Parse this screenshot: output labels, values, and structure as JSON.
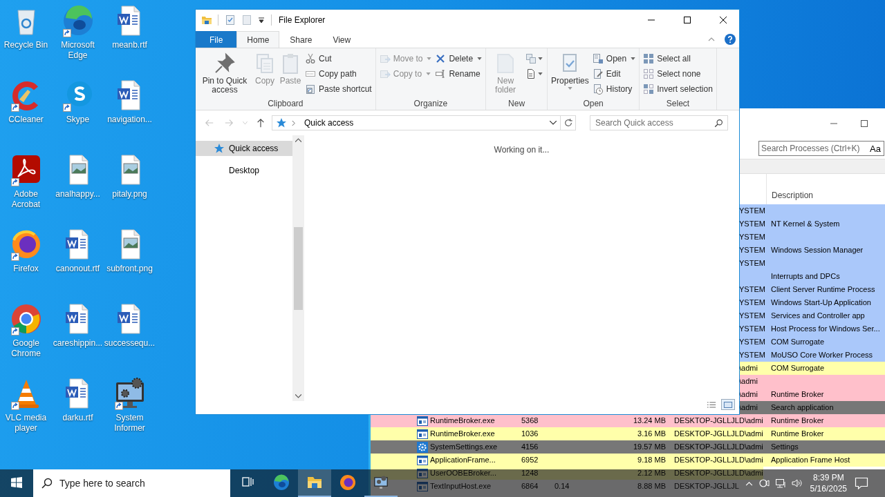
{
  "desktop_icons": [
    {
      "label": "Recycle Bin",
      "kind": "recycle",
      "shortcut": false
    },
    {
      "label": "Microsoft Edge",
      "kind": "edge",
      "shortcut": true
    },
    {
      "label": "meanb.rtf",
      "kind": "word",
      "shortcut": false
    },
    {
      "label": "CCleaner",
      "kind": "ccleaner",
      "shortcut": true
    },
    {
      "label": "Skype",
      "kind": "skype",
      "shortcut": true
    },
    {
      "label": "navigation...",
      "kind": "word",
      "shortcut": false
    },
    {
      "label": "Adobe Acrobat",
      "kind": "acrobat",
      "shortcut": true
    },
    {
      "label": "analhappy...",
      "kind": "image",
      "shortcut": false
    },
    {
      "label": "pitaly.png",
      "kind": "image",
      "shortcut": false
    },
    {
      "label": "Firefox",
      "kind": "firefox",
      "shortcut": true
    },
    {
      "label": "canonout.rtf",
      "kind": "word",
      "shortcut": false
    },
    {
      "label": "subfront.png",
      "kind": "image",
      "shortcut": false
    },
    {
      "label": "Google Chrome",
      "kind": "chrome",
      "shortcut": true
    },
    {
      "label": "careshippin...",
      "kind": "word",
      "shortcut": false
    },
    {
      "label": "successequ...",
      "kind": "word",
      "shortcut": false
    },
    {
      "label": "VLC media player",
      "kind": "vlc",
      "shortcut": true
    },
    {
      "label": "darku.rtf",
      "kind": "word",
      "shortcut": false
    },
    {
      "label": "System Informer",
      "kind": "sysinf",
      "shortcut": true
    }
  ],
  "explorer": {
    "title": "File Explorer",
    "tabs": [
      {
        "label": "File",
        "kind": "file",
        "selected": false
      },
      {
        "label": "Home",
        "kind": "tab",
        "selected": true
      },
      {
        "label": "Share",
        "kind": "tab",
        "selected": false
      },
      {
        "label": "View",
        "kind": "tab",
        "selected": false
      }
    ],
    "ribbon": [
      {
        "label": "Clipboard",
        "columns": [
          [
            {
              "label": "Pin to Quick access",
              "kind": "large",
              "disabled": false,
              "dropdown": false
            }
          ],
          [
            {
              "label": "Copy",
              "kind": "large",
              "disabled": true,
              "dropdown": false
            }
          ],
          [
            {
              "label": "Paste",
              "kind": "large",
              "disabled": true,
              "dropdown": false
            }
          ],
          [
            {
              "label": "Cut",
              "kind": "small",
              "disabled": false,
              "dropdown": false
            },
            {
              "label": "Copy path",
              "kind": "small",
              "disabled": false,
              "dropdown": false
            },
            {
              "label": "Paste shortcut",
              "kind": "small",
              "disabled": false,
              "dropdown": false
            }
          ]
        ]
      },
      {
        "label": "Organize",
        "columns": [
          [
            {
              "label": "Move to",
              "kind": "small",
              "disabled": true,
              "dropdown": true
            },
            {
              "label": "Copy to",
              "kind": "small",
              "disabled": true,
              "dropdown": true
            }
          ],
          [
            {
              "label": "Delete",
              "kind": "small",
              "disabled": false,
              "dropdown": true
            },
            {
              "label": "Rename",
              "kind": "small",
              "disabled": false,
              "dropdown": false
            }
          ]
        ]
      },
      {
        "label": "New",
        "columns": [
          [
            {
              "label": "New folder",
              "kind": "large",
              "disabled": true,
              "dropdown": false
            }
          ],
          [
            {
              "kind": "icon",
              "disabled": false,
              "dropdown": true
            },
            {
              "kind": "icon",
              "disabled": false,
              "dropdown": true
            }
          ]
        ]
      },
      {
        "label": "Open",
        "columns": [
          [
            {
              "label": "Properties",
              "kind": "large",
              "disabled": false,
              "dropdown": true
            }
          ],
          [
            {
              "label": "Open",
              "kind": "small",
              "disabled": false,
              "dropdown": true
            },
            {
              "label": "Edit",
              "kind": "small",
              "disabled": false,
              "dropdown": false
            },
            {
              "label": "History",
              "kind": "small",
              "disabled": false,
              "dropdown": false
            }
          ]
        ]
      },
      {
        "label": "Select",
        "columns": [
          [
            {
              "label": "Select all",
              "kind": "small",
              "disabled": false,
              "dropdown": false
            },
            {
              "label": "Select none",
              "kind": "small",
              "disabled": false,
              "dropdown": false
            },
            {
              "label": "Invert selection",
              "kind": "small",
              "disabled": false,
              "dropdown": false
            }
          ]
        ]
      }
    ],
    "address": "Quick access",
    "search_placeholder": "Search Quick access",
    "nav": [
      {
        "label": "Quick access",
        "selected": true
      },
      {
        "label": "Desktop",
        "selected": false
      }
    ],
    "status": "Working on it..."
  },
  "process_window": {
    "search_placeholder": "Search Processes (Ctrl+K)",
    "case_toggle": "Aa",
    "columns": [
      {
        "label": "Description"
      }
    ],
    "rows": [
      {
        "kind": "covered",
        "user": "YSTEM",
        "color": "#aac8fa"
      },
      {
        "kind": "covered",
        "user": "YSTEM",
        "description": "NT Kernel & System",
        "color": "#aac8fa"
      },
      {
        "kind": "covered",
        "user": "YSTEM",
        "color": "#aac8fa"
      },
      {
        "kind": "covered",
        "user": "YSTEM",
        "description": "Windows Session Manager",
        "color": "#aac8fa"
      },
      {
        "kind": "covered",
        "user": "YSTEM",
        "color": "#aac8fa"
      },
      {
        "kind": "covered",
        "description": "Interrupts and DPCs",
        "color": "#aac8fa"
      },
      {
        "kind": "covered",
        "user": "YSTEM",
        "description": "Client Server Runtime Process",
        "color": "#aac8fa"
      },
      {
        "kind": "covered",
        "user": "YSTEM",
        "description": "Windows Start-Up Application",
        "color": "#aac8fa"
      },
      {
        "kind": "covered",
        "user": "YSTEM",
        "description": "Services and Controller app",
        "color": "#aac8fa"
      },
      {
        "kind": "covered",
        "user": "YSTEM",
        "description": "Host Process for Windows Ser...",
        "color": "#aac8fa"
      },
      {
        "kind": "covered",
        "user": "YSTEM",
        "description": "COM Surrogate",
        "color": "#aac8fa"
      },
      {
        "kind": "covered",
        "user": "YSTEM",
        "description": "MoUSO Core Worker Process",
        "color": "#aac8fa"
      },
      {
        "kind": "covered",
        "user": "\\admi",
        "description": "COM Surrogate",
        "color": "#ffffaa"
      },
      {
        "kind": "covered",
        "user": "\\admi",
        "color": "#ffc0cb"
      },
      {
        "kind": "covered",
        "user": "\\admi",
        "description": "Runtime Broker",
        "color": "#ffc0cb"
      },
      {
        "kind": "covered",
        "user": "\\admi",
        "description": "Search application",
        "color": "#777777"
      },
      {
        "kind": "app",
        "name": "RuntimeBroker.exe",
        "pid": "5368",
        "private_bytes": "13.24 MB",
        "user": "DESKTOP-JGLLJLD\\admi",
        "description": "Runtime Broker",
        "color": "#ffc0cb"
      },
      {
        "kind": "app",
        "name": "RuntimeBroker.exe",
        "pid": "1036",
        "private_bytes": "3.16 MB",
        "user": "DESKTOP-JGLLJLD\\admi",
        "description": "Runtime Broker",
        "color": "#ffffaa"
      },
      {
        "kind": "settings",
        "name": "SystemSettings.exe",
        "pid": "4156",
        "private_bytes": "19.57 MB",
        "user": "DESKTOP-JGLLJLD\\admi",
        "description": "Settings",
        "color": "#777777"
      },
      {
        "kind": "app",
        "name": "ApplicationFrame...",
        "pid": "6952",
        "private_bytes": "9.18 MB",
        "user": "DESKTOP-JGLLJLD\\admi",
        "description": "Application Frame Host",
        "color": "#ffffaa"
      },
      {
        "kind": "app",
        "name": "UserOOBEBroker...",
        "pid": "1248",
        "private_bytes": "2.12 MB",
        "user": "DESKTOP-JGLLJLD\\admi",
        "color": "#ffffaa"
      },
      {
        "kind": "app",
        "name": "TextInputHost.exe",
        "pid": "6864",
        "cpu": "0.14",
        "private_bytes": "8.88 MB",
        "user": "DESKTOP-JGLLJL"
      }
    ]
  },
  "taskbar": {
    "search_placeholder": "Type here to search",
    "apps": [
      {
        "kind": "taskview",
        "active": false,
        "running": false
      },
      {
        "kind": "edge",
        "active": false,
        "running": false
      },
      {
        "kind": "explorer",
        "active": true,
        "running": true
      },
      {
        "kind": "firefox",
        "active": false,
        "running": false
      },
      {
        "kind": "sysinf",
        "active": false,
        "running": true
      }
    ],
    "time": "8:39 PM",
    "date": "5/16/2025"
  }
}
